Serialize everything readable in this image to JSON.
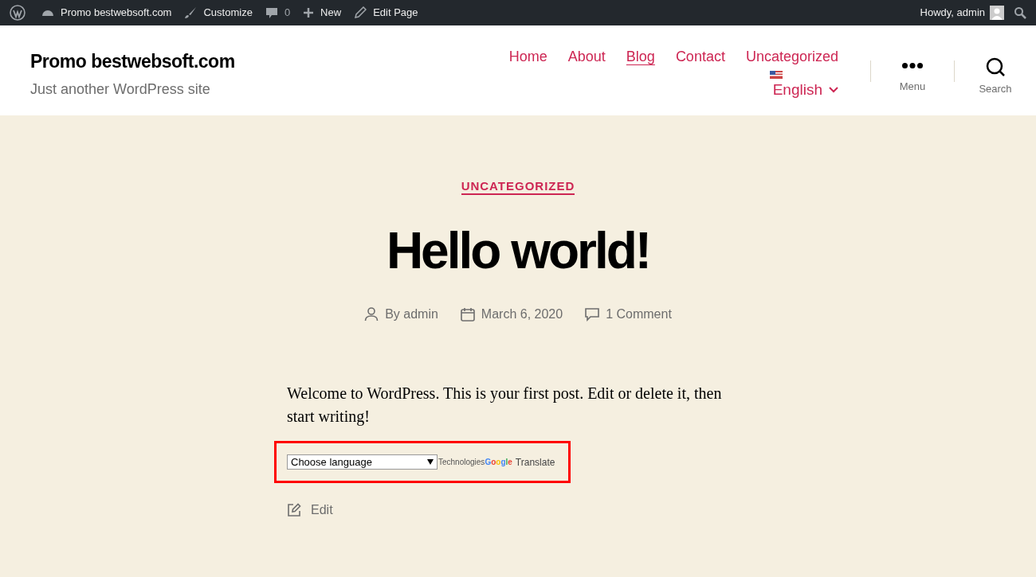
{
  "admin_bar": {
    "site": "Promo bestwebsoft.com",
    "customize": "Customize",
    "comments": "0",
    "new": "New",
    "edit_page": "Edit Page",
    "greeting": "Howdy, admin"
  },
  "header": {
    "site_title": "Promo bestwebsoft.com",
    "tagline": "Just another WordPress site",
    "nav": [
      {
        "label": "Home",
        "selected": false
      },
      {
        "label": "About",
        "selected": false
      },
      {
        "label": "Blog",
        "selected": true
      },
      {
        "label": "Contact",
        "selected": false
      },
      {
        "label": "Uncategorized",
        "selected": false
      }
    ],
    "language": "English",
    "menu_label": "Menu",
    "search_label": "Search"
  },
  "post": {
    "category": "UNCATEGORIZED",
    "title": "Hello world!",
    "author": "By admin",
    "date": "March 6, 2020",
    "comments": "1 Comment",
    "body": "Welcome to WordPress. This is your first post. Edit or delete it, then start writing!",
    "translate": {
      "select": "Choose language",
      "technologies": "Technologies",
      "google": "Google",
      "translate": "Translate"
    },
    "edit": "Edit"
  }
}
